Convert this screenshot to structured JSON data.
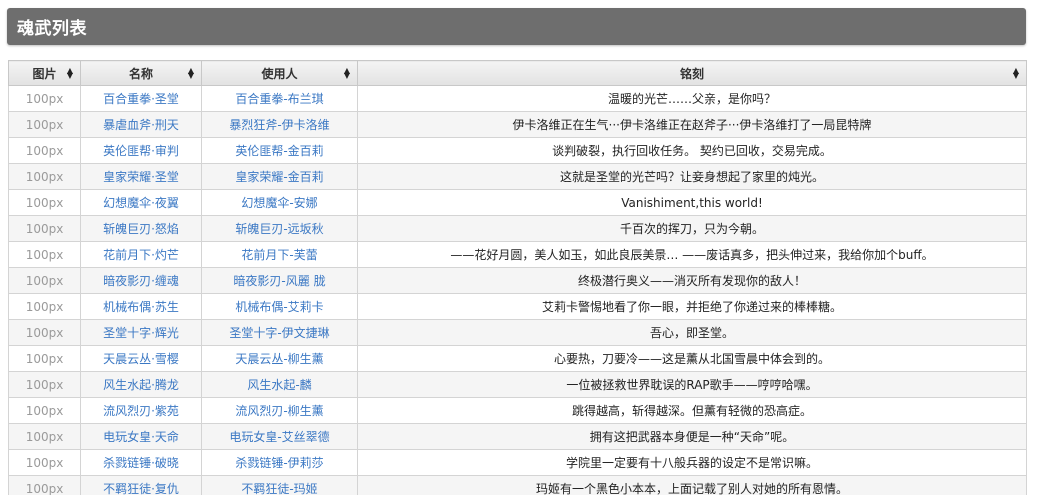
{
  "page": {
    "title": "魂武列表"
  },
  "table": {
    "headers": {
      "image": "图片",
      "name": "名称",
      "user": "使用人",
      "inscription": "铭刻"
    },
    "rows": [
      {
        "image": "100px",
        "name": "百合重拳·圣堂",
        "user": "百合重拳-布兰琪",
        "inscription": "温暖的光芒……父亲，是你吗？"
      },
      {
        "image": "100px",
        "name": "暴虐血斧·刑天",
        "user": "暴烈狂斧-伊卡洛维",
        "inscription": "伊卡洛维正在生气···伊卡洛维正在赵斧子···伊卡洛维打了一局昆特牌"
      },
      {
        "image": "100px",
        "name": "英伦匪帮·审判",
        "user": "英伦匪帮-金百莉",
        "inscription": "谈判破裂，执行回收任务。 契约已回收，交易完成。"
      },
      {
        "image": "100px",
        "name": "皇家荣耀·圣堂",
        "user": "皇家荣耀-金百莉",
        "inscription": "这就是圣堂的光芒吗？让妾身想起了家里的炖光。"
      },
      {
        "image": "100px",
        "name": "幻想魔伞·夜翼",
        "user": "幻想魔伞-安娜",
        "inscription": "Vanishiment,this world!"
      },
      {
        "image": "100px",
        "name": "斩魄巨刃·怒焰",
        "user": "斩魄巨刃-远坂秋",
        "inscription": "千百次的挥刀，只为今朝。"
      },
      {
        "image": "100px",
        "name": "花前月下·灼芒",
        "user": "花前月下-芙蕾",
        "inscription": "——花好月圆，美人如玉，如此良辰美景… ——废话真多，把头伸过来，我给你加个buff。"
      },
      {
        "image": "100px",
        "name": "暗夜影刃·缠魂",
        "user": "暗夜影刃-风麗 胧",
        "inscription": "终极潜行奥义——消灭所有发现你的敌人！"
      },
      {
        "image": "100px",
        "name": "机械布偶·苏生",
        "user": "机械布偶-艾莉卡",
        "inscription": "艾莉卡警惕地看了你一眼，并拒绝了你递过来的棒棒糖。"
      },
      {
        "image": "100px",
        "name": "圣堂十字·辉光",
        "user": "圣堂十字-伊文捷琳",
        "inscription": "吾心，即圣堂。"
      },
      {
        "image": "100px",
        "name": "天晨云丛·雪樱",
        "user": "天晨云丛-柳生薰",
        "inscription": "心要热，刀要冷——这是薰从北国雪晨中体会到的。"
      },
      {
        "image": "100px",
        "name": "风生水起·腾龙",
        "user": "风生水起-麟",
        "inscription": "一位被拯救世界耽误的RAP歌手——哼哼哈嘿。"
      },
      {
        "image": "100px",
        "name": "流风烈刃·紫苑",
        "user": "流风烈刃-柳生薰",
        "inscription": "跳得越高，斩得越深。但薰有轻微的恐高症。"
      },
      {
        "image": "100px",
        "name": "电玩女皇·天命",
        "user": "电玩女皇-艾丝翠德",
        "inscription": "拥有这把武器本身便是一种“天命”呢。"
      },
      {
        "image": "100px",
        "name": "杀戮链锤·破晓",
        "user": "杀戮链锤-伊莉莎",
        "inscription": "学院里一定要有十八般兵器的设定不是常识嘛。"
      },
      {
        "image": "100px",
        "name": "不羁狂徒·复仇",
        "user": "不羁狂徒-玛姬",
        "inscription": "玛姬有一个黑色小本本，上面记载了别人对她的所有恩情。"
      }
    ]
  },
  "icons": {
    "sort": "sort-both-icon"
  },
  "colors": {
    "title_bar": "#6e6e6e",
    "link": "#3b78c4",
    "image_placeholder": "#9a9a9a"
  }
}
